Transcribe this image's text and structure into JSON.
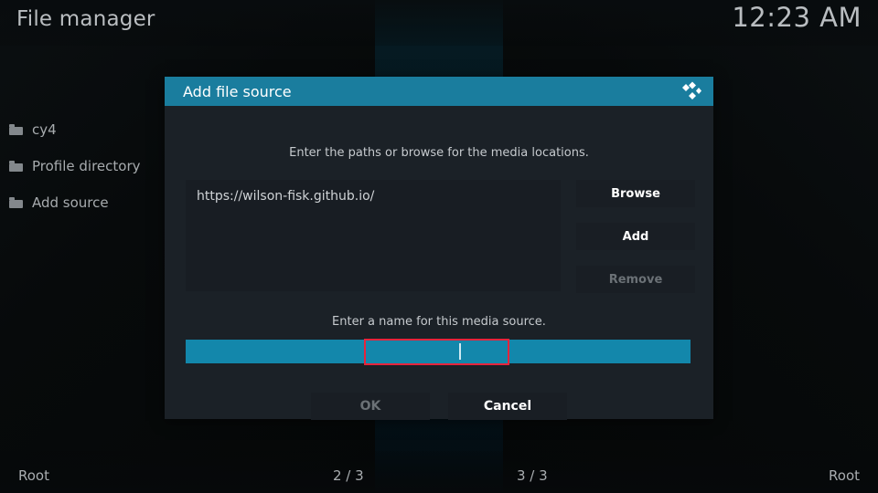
{
  "header": {
    "title": "File manager",
    "clock": "12:23 AM"
  },
  "sidebar": {
    "items": [
      {
        "label": "cy4",
        "icon": "folder-icon"
      },
      {
        "label": "Profile directory",
        "icon": "folder-icon"
      },
      {
        "label": "Add source",
        "icon": "folder-icon"
      }
    ]
  },
  "dialog": {
    "title": "Add file source",
    "logo_icon": "kodi-logo-icon",
    "paths_hint": "Enter the paths or browse for the media locations.",
    "path_value": "https://wilson-fisk.github.io/",
    "buttons": {
      "browse": "Browse",
      "add": "Add",
      "remove": "Remove"
    },
    "name_hint": "Enter a name for this media source.",
    "name_value": "",
    "name_placeholder": "",
    "ok": "OK",
    "cancel": "Cancel"
  },
  "footer": {
    "left": "Root",
    "center_left": "2 / 3",
    "center_right": "3 / 3",
    "right": "Root"
  },
  "colors": {
    "accent_header": "#1a7d9e",
    "accent_input": "#1387ab",
    "highlight": "#e8243c",
    "dialog_bg": "#1b2127",
    "button_bg": "#191e24",
    "text_primary": "#ffffff",
    "text_muted": "#6b7176",
    "screen_bg": "#050708"
  }
}
